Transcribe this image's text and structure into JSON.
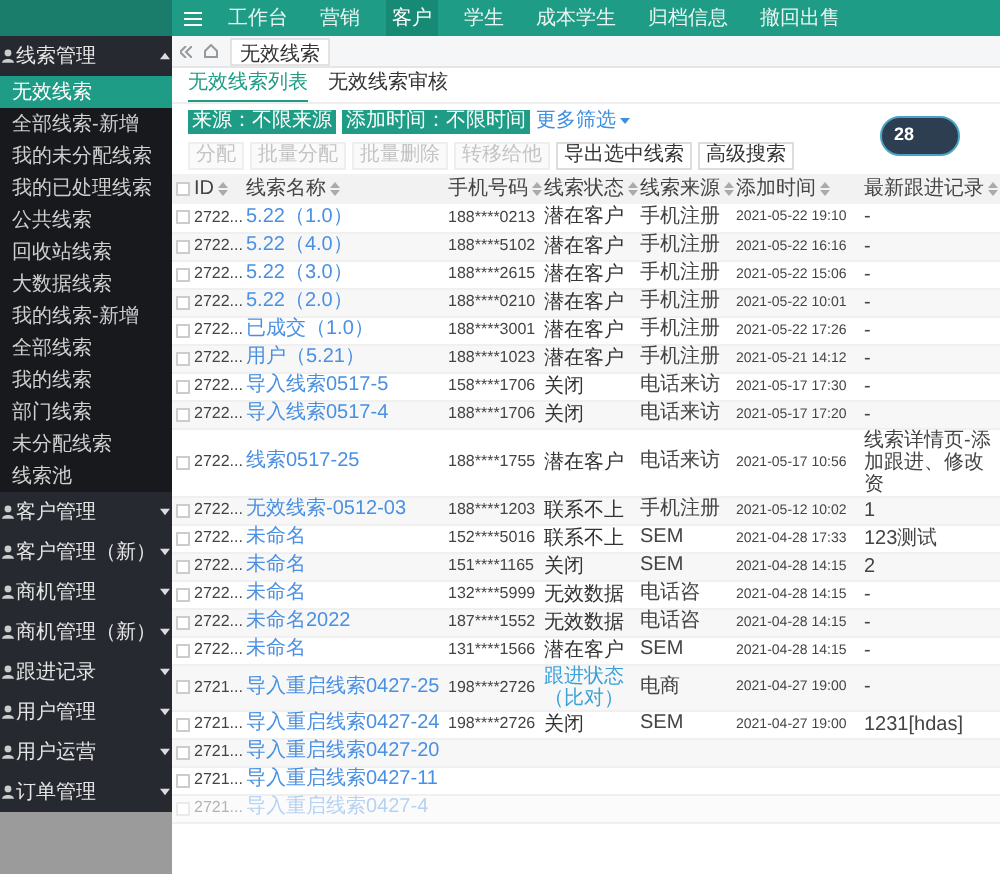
{
  "top_nav": [
    {
      "label": "工作台",
      "selected": false
    },
    {
      "label": "营销",
      "selected": false
    },
    {
      "label": "客户",
      "selected": true
    },
    {
      "label": "学生",
      "selected": false
    },
    {
      "label": "成本学生",
      "selected": false
    },
    {
      "label": "归档信息",
      "selected": false
    },
    {
      "label": "撤回出售",
      "selected": false
    }
  ],
  "sidebar": {
    "items": [
      {
        "label": "线索管理",
        "expanded": true,
        "children": [
          {
            "label": "无效线索",
            "selected": true
          },
          {
            "label": "全部线索-新增",
            "selected": false
          },
          {
            "label": "我的未分配线索",
            "selected": false
          },
          {
            "label": "我的已处理线索",
            "selected": false
          },
          {
            "label": "公共线索",
            "selected": false
          },
          {
            "label": "回收站线索",
            "selected": false
          },
          {
            "label": "大数据线索",
            "selected": false
          },
          {
            "label": "我的线索-新增",
            "selected": false
          },
          {
            "label": "全部线索",
            "selected": false
          },
          {
            "label": "我的线索",
            "selected": false
          },
          {
            "label": "部门线索",
            "selected": false
          },
          {
            "label": "未分配线索",
            "selected": false
          },
          {
            "label": "线索池",
            "selected": false
          }
        ]
      },
      {
        "label": "客户管理",
        "expanded": false
      },
      {
        "label": "客户管理（新）",
        "expanded": false
      },
      {
        "label": "商机管理",
        "expanded": false
      },
      {
        "label": "商机管理（新）",
        "expanded": false
      },
      {
        "label": "跟进记录",
        "expanded": false
      },
      {
        "label": "用户管理",
        "expanded": false
      },
      {
        "label": "用户运营",
        "expanded": false
      },
      {
        "label": "订单管理",
        "expanded": false
      }
    ]
  },
  "page_tab": {
    "label": "无效线索"
  },
  "sub_tabs": [
    {
      "label": "无效线索列表",
      "selected": true
    },
    {
      "label": "无效线索审核",
      "selected": false
    }
  ],
  "filters": [
    "来源：不限来源",
    "添加时间：不限时间"
  ],
  "more_filters": "更多筛选",
  "actions": [
    {
      "label": "分配",
      "disabled": true
    },
    {
      "label": "批量分配",
      "disabled": true
    },
    {
      "label": "批量删除",
      "disabled": true
    },
    {
      "label": "转移给他",
      "disabled": true
    },
    {
      "label": "导出选中线索",
      "disabled": false
    },
    {
      "label": "高级搜索",
      "disabled": false
    }
  ],
  "table": {
    "all_checked": false,
    "columns": [
      "ID",
      "线索名称",
      "手机号码",
      "线索状态",
      "线索来源",
      "添加时间",
      "最新跟进记录"
    ],
    "rows": [
      {
        "id": "2722...",
        "name": "5.22（1.0）",
        "phone": "188****0213",
        "status": "潜在客户",
        "source": "手机注册",
        "time": "2021-05-22 19:10",
        "note": "-",
        "dimmed": false
      },
      {
        "id": "2722...",
        "name": "5.22（4.0）",
        "phone": "188****5102",
        "status": "潜在客户",
        "source": "手机注册",
        "time": "2021-05-22 16:16",
        "note": "-",
        "dimmed": false
      },
      {
        "id": "2722...",
        "name": "5.22（3.0）",
        "phone": "188****2615",
        "status": "潜在客户",
        "source": "手机注册",
        "time": "2021-05-22 15:06",
        "note": "-",
        "dimmed": false
      },
      {
        "id": "2722...",
        "name": "5.22（2.0）",
        "phone": "188****0210",
        "status": "潜在客户",
        "source": "手机注册",
        "time": "2021-05-22 10:01",
        "note": "-",
        "dimmed": false
      },
      {
        "id": "2722...",
        "name": "已成交（1.0）",
        "phone": "188****3001",
        "status": "潜在客户",
        "source": "手机注册",
        "time": "2021-05-22 17:26",
        "note": "-",
        "dimmed": false
      },
      {
        "id": "2722...",
        "name": "用户（5.21）",
        "phone": "188****1023",
        "status": "潜在客户",
        "source": "手机注册",
        "time": "2021-05-21 14:12",
        "note": "-",
        "dimmed": false
      },
      {
        "id": "2722...",
        "name": "导入线索0517-5",
        "phone": "158****1706",
        "status": "关闭",
        "source": "电话来访",
        "time": "2021-05-17 17:30",
        "note": "-",
        "dimmed": false
      },
      {
        "id": "2722...",
        "name": "导入线索0517-4",
        "phone": "188****1706",
        "status": "关闭",
        "source": "电话来访",
        "time": "2021-05-17 17:20",
        "note": "-",
        "dimmed": false
      },
      {
        "id": "2722...",
        "name": "线索0517-25",
        "phone": "188****1755",
        "status": "潜在客户",
        "source": "电话来访",
        "time": "2021-05-17 10:56",
        "note": "线索详情页-添加跟进、修改资",
        "dimmed": false
      },
      {
        "id": "2722...",
        "name": "无效线索-0512-03",
        "phone": "188****1203",
        "status": "联系不上",
        "source": "手机注册",
        "time": "2021-05-12 10:02",
        "note": "1",
        "dimmed": false
      },
      {
        "id": "2722...",
        "name": "未命名",
        "phone": "152****5016",
        "status": "联系不上",
        "source": "SEM",
        "time": "2021-04-28 17:33",
        "note": "123测试",
        "dimmed": false
      },
      {
        "id": "2722...",
        "name": "未命名",
        "phone": "151****1165",
        "status": "关闭",
        "source": "SEM",
        "time": "2021-04-28 14:15",
        "note": "2",
        "dimmed": false
      },
      {
        "id": "2722...",
        "name": "未命名",
        "phone": "132****5999",
        "status": "无效数据",
        "source": "电话咨",
        "time": "2021-04-28 14:15",
        "note": "-",
        "dimmed": false
      },
      {
        "id": "2722...",
        "name": "未命名2022",
        "phone": "187****1552",
        "status": "无效数据",
        "source": "电话咨",
        "time": "2021-04-28 14:15",
        "note": "-",
        "dimmed": false
      },
      {
        "id": "2722...",
        "name": "未命名",
        "phone": "131****1566",
        "status": "潜在客户",
        "source": "SEM",
        "time": "2021-04-28 14:15",
        "note": "-",
        "dimmed": false
      },
      {
        "id": "2721...",
        "name": "导入重启线索0427-25",
        "phone": "198****2726",
        "status": "跟进状态（比对）",
        "status_link": true,
        "source": "电商",
        "time": "2021-04-27 19:00",
        "note": "-",
        "dimmed": false
      },
      {
        "id": "2721...",
        "name": "导入重启线索0427-24",
        "phone": "198****2726",
        "status": "关闭",
        "source": "SEM",
        "time": "2021-04-27 19:00",
        "note": "1231[hdas]",
        "dimmed": false
      },
      {
        "id": "2721...",
        "name": "导入重启线索0427-20",
        "dimmed": false
      },
      {
        "id": "2721...",
        "name": "导入重启线索0427-11",
        "dimmed": false
      },
      {
        "id": "2721...",
        "name": "导入重启线索0427-4",
        "dimmed": true
      }
    ]
  },
  "floating_widget": {
    "value": "28"
  }
}
